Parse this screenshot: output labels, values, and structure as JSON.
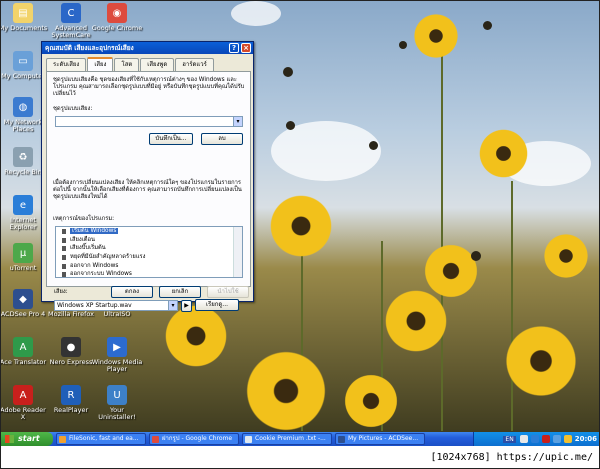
{
  "desktop_icons": [
    {
      "label": "My Documents",
      "icon": "my-documents-icon",
      "color": "#f2d36a",
      "glyph": "▤"
    },
    {
      "label": "Advanced SystemCare",
      "icon": "advanced-systemcare-icon",
      "color": "#2a67c8",
      "glyph": "C"
    },
    {
      "label": "Google Chrome",
      "icon": "chrome-icon",
      "color": "#dd4b3e",
      "glyph": "◉"
    },
    {
      "label": "My Computer",
      "icon": "my-computer-icon",
      "color": "#6aa0d8",
      "glyph": "▭"
    },
    {
      "label": "My Network Places",
      "icon": "network-places-icon",
      "color": "#3b7bd0",
      "glyph": "◍"
    },
    {
      "label": "Recycle Bin",
      "icon": "recycle-bin-icon",
      "color": "#8aa0b0",
      "glyph": "♻"
    },
    {
      "label": "Internet Explorer",
      "icon": "internet-explorer-icon",
      "color": "#2a7ed8",
      "glyph": "e"
    },
    {
      "label": "uTorrent",
      "icon": "utorrent-icon",
      "color": "#4da84a",
      "glyph": "µ"
    },
    {
      "label": "ACDSee Pro 4",
      "icon": "acdsee-icon",
      "color": "#2d4f8f",
      "glyph": "◆"
    },
    {
      "label": "Mozilla Firefox",
      "icon": "firefox-icon",
      "color": "#e66a1f",
      "glyph": "◐"
    },
    {
      "label": "UltraISO",
      "icon": "ultraiso-icon",
      "color": "#7a8e9c",
      "glyph": "◎"
    },
    {
      "label": "Ace Translator",
      "icon": "ace-translator-icon",
      "color": "#2f9a4a",
      "glyph": "A"
    },
    {
      "label": "Nero Express",
      "icon": "nero-express-icon",
      "color": "#333333",
      "glyph": "●"
    },
    {
      "label": "Windows Media Player",
      "icon": "media-player-icon",
      "color": "#2c6bd0",
      "glyph": "▶"
    },
    {
      "label": "Adobe Reader X",
      "icon": "adobe-reader-icon",
      "color": "#c8201c",
      "glyph": "A"
    },
    {
      "label": "RealPlayer",
      "icon": "realplayer-icon",
      "color": "#1f5fb8",
      "glyph": "R"
    },
    {
      "label": "Your Uninstaller!",
      "icon": "your-uninstaller-icon",
      "color": "#3d80c8",
      "glyph": "U"
    }
  ],
  "dialog": {
    "title": "คุณสมบัติ เสียงและอุปกรณ์เสียง",
    "help_button": "?",
    "close_button": "×",
    "tabs": [
      {
        "label": "ระดับเสียง",
        "active": false
      },
      {
        "label": "เสียง",
        "active": true
      },
      {
        "label": "โสต",
        "active": false
      },
      {
        "label": "เสียงพูด",
        "active": false
      },
      {
        "label": "ฮาร์ดแวร์",
        "active": false
      }
    ],
    "intro_text": "ชุดรูปแบบเสียงคือ ชุดของเสียงที่ใช้กับเหตุการณ์ต่างๆ ของ Windows และโปรแกรม คุณสามารถเลือกชุดรูปแบบที่มีอยู่ หรือบันทึกชุดรูปแบบที่คุณได้ปรับเปลี่ยนไว้",
    "scheme_label": "ชุดรูปแบบเสียง:",
    "scheme_value": "",
    "save_as_button": "บันทึกเป็น...",
    "delete_button": "ลบ",
    "events_text": "เมื่อต้องการเปลี่ยนแปลงเสียง ให้คลิกเหตุการณ์ใดๆ ของโปรแกรมในรายการต่อไปนี้ จากนั้นให้เลือกเสียงที่ต้องการ คุณสามารถบันทึกการเปลี่ยนแปลงเป็นชุดรูปแบบเสียงใหม่ได้",
    "events_label": "เหตุการณ์ของโปรแกรม:",
    "events": [
      {
        "label": "เริ่มต้น Windows",
        "selected": true
      },
      {
        "label": "เสียงเตือน",
        "selected": false
      },
      {
        "label": "เสียงบี๊บเริ่มต้น",
        "selected": false
      },
      {
        "label": "หยุดที่มีนัยสำคัญหลาดร้ายแรง",
        "selected": false
      },
      {
        "label": "ออกจาก Windows",
        "selected": false
      },
      {
        "label": "ออกจากระบบ Windows",
        "selected": false
      }
    ],
    "sound_label": "เสียง:",
    "sound_value": "Windows XP Startup.wav",
    "browse_button": "เรียกดู...",
    "ok_button": "ตกลง",
    "cancel_button": "ยกเลิก",
    "apply_button": "นำไปใช้"
  },
  "taskbar": {
    "start_label": "start",
    "tasks": [
      {
        "label": "FileSonic, fast and ea...",
        "icon": "firefox-icon"
      },
      {
        "label": "ฝากรูป - Google Chrome",
        "icon": "chrome-icon"
      },
      {
        "label": "Cookie Premium .txt -...",
        "icon": "notepad-icon"
      },
      {
        "label": "My Pictures - ACDSee...",
        "icon": "acdsee-icon"
      }
    ],
    "language": "EN",
    "clock": "20:06"
  },
  "watermark": "[1024x768] https://upic.me/"
}
